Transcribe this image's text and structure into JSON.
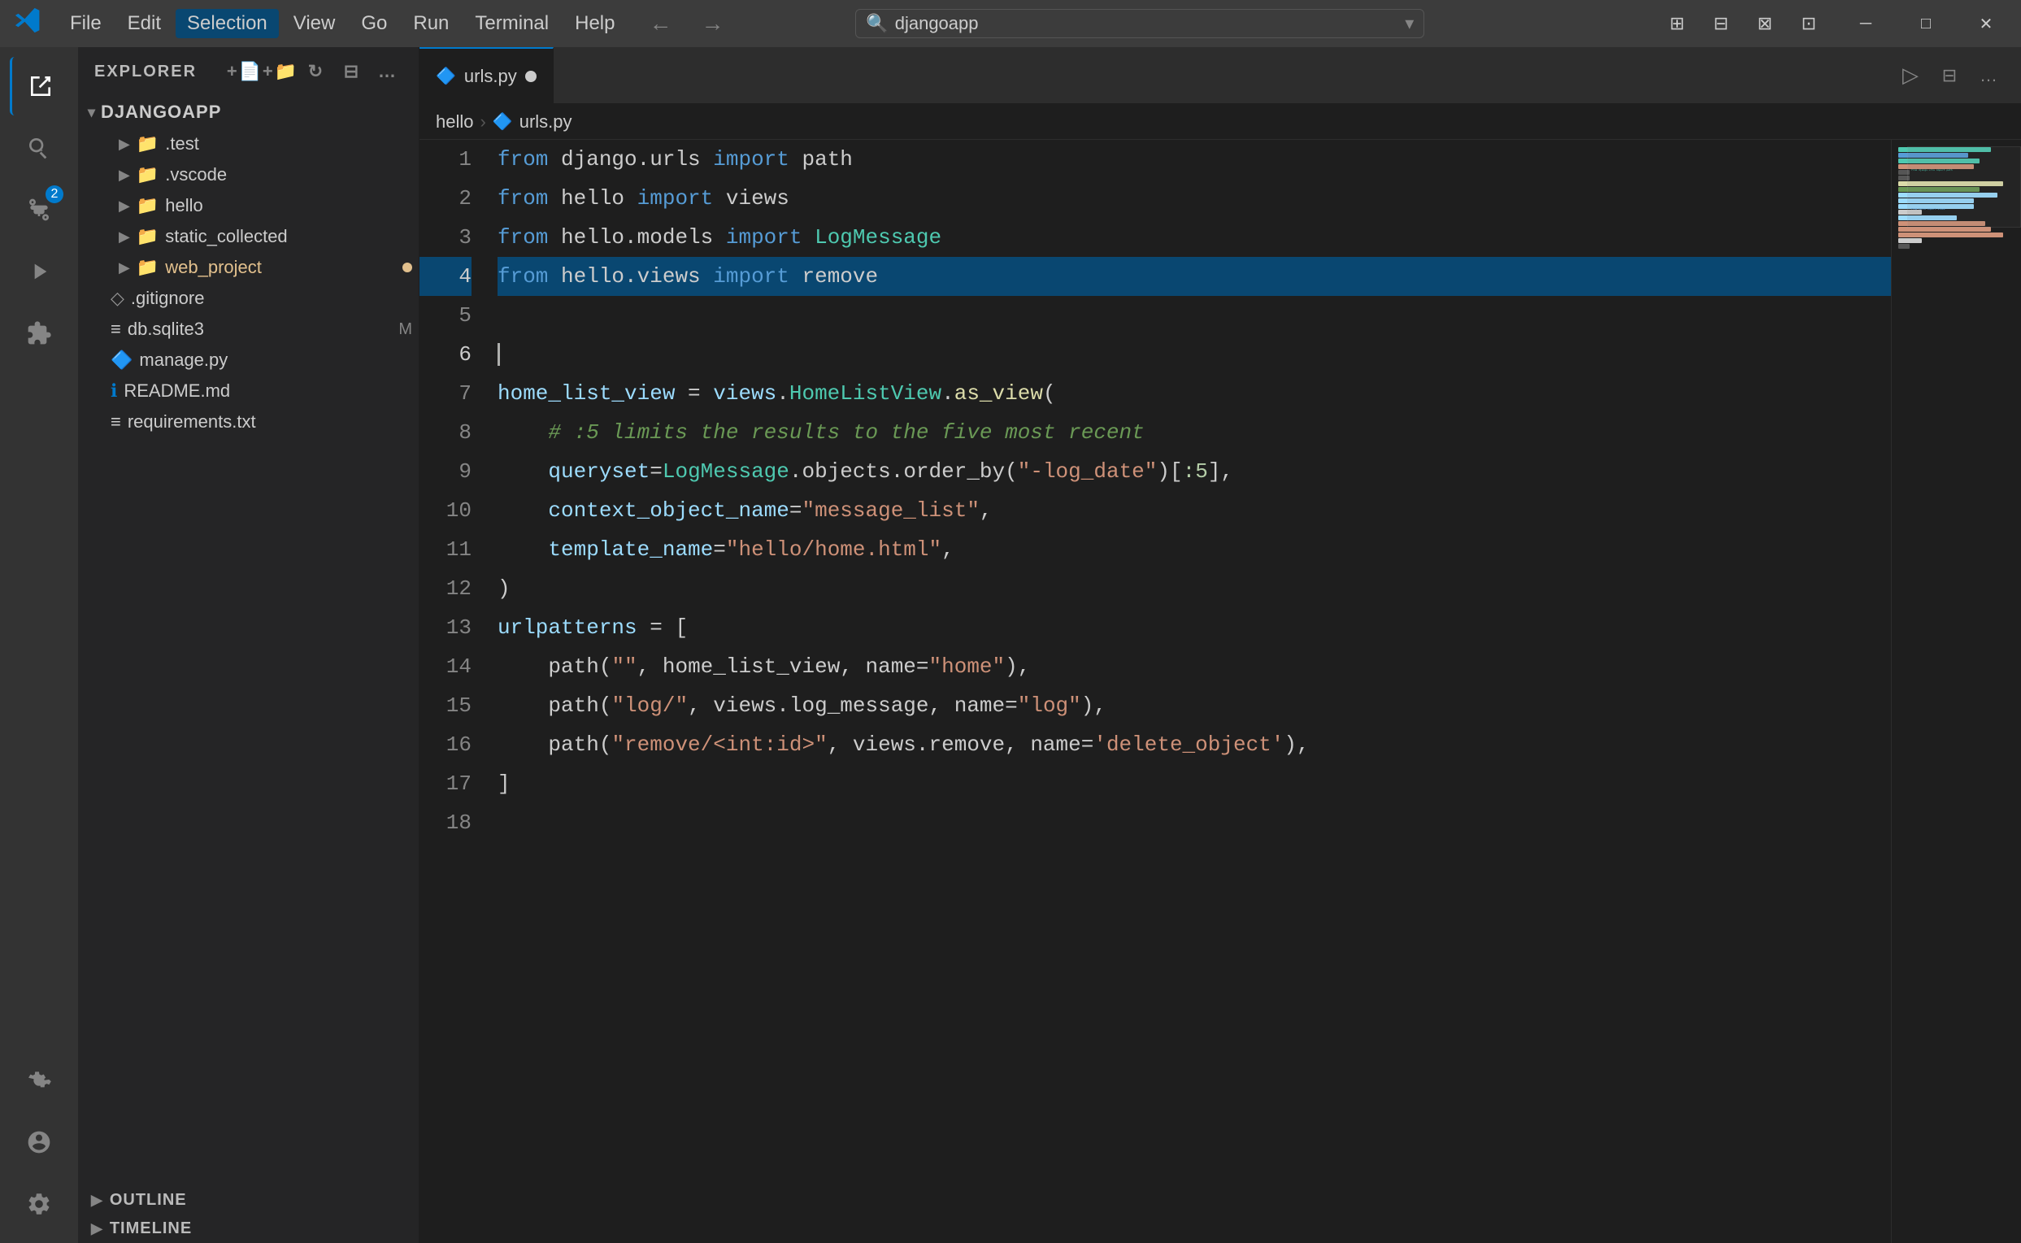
{
  "titlebar": {
    "logo": "vscode-logo",
    "menu": [
      {
        "label": "File",
        "id": "file"
      },
      {
        "label": "Edit",
        "id": "edit"
      },
      {
        "label": "Selection",
        "id": "selection",
        "active": true
      },
      {
        "label": "View",
        "id": "view"
      },
      {
        "label": "Go",
        "id": "go"
      },
      {
        "label": "Run",
        "id": "run"
      },
      {
        "label": "Terminal",
        "id": "terminal"
      },
      {
        "label": "Help",
        "id": "help"
      }
    ],
    "search_placeholder": "djangoapp",
    "nav_back": "←",
    "nav_fwd": "→",
    "layout_icons": [
      "⊞",
      "⊟",
      "⊠",
      "⊡"
    ],
    "win_minimize": "─",
    "win_maximize": "□",
    "win_close": "✕"
  },
  "activity_bar": {
    "icons": [
      {
        "name": "explorer",
        "glyph": "📄",
        "active": true,
        "badge": null
      },
      {
        "name": "search",
        "glyph": "🔍",
        "active": false
      },
      {
        "name": "source-control",
        "glyph": "⎇",
        "active": false,
        "badge": "2"
      },
      {
        "name": "run-debug",
        "glyph": "▷",
        "active": false
      },
      {
        "name": "extensions",
        "glyph": "⊞",
        "active": false
      }
    ],
    "bottom_icons": [
      {
        "name": "remote",
        "glyph": "⊵"
      },
      {
        "name": "account",
        "glyph": "👤"
      },
      {
        "name": "settings",
        "glyph": "⚙"
      }
    ]
  },
  "sidebar": {
    "title": "Explorer",
    "project_name": "DJANGOAPP",
    "folders": [
      {
        "name": ".test",
        "type": "folder",
        "indent": 1
      },
      {
        "name": ".vscode",
        "type": "folder",
        "indent": 1
      },
      {
        "name": "hello",
        "type": "folder",
        "indent": 1
      },
      {
        "name": "static_collected",
        "type": "folder",
        "indent": 1
      },
      {
        "name": "web_project",
        "type": "folder",
        "indent": 1,
        "modified": true
      },
      {
        "name": ".gitignore",
        "type": "file",
        "icon": "◇",
        "indent": 1
      },
      {
        "name": "db.sqlite3",
        "type": "file",
        "icon": "≡",
        "indent": 1,
        "badge": "M"
      },
      {
        "name": "manage.py",
        "type": "file",
        "icon": "🔷",
        "indent": 1
      },
      {
        "name": "README.md",
        "type": "file",
        "icon": "ℹ",
        "indent": 1
      },
      {
        "name": "requirements.txt",
        "type": "file",
        "icon": "≡",
        "indent": 1
      }
    ],
    "outline_label": "Outline",
    "timeline_label": "Timeline"
  },
  "tabs": [
    {
      "label": "urls.py",
      "active": true,
      "unsaved": true,
      "icon": "🔷"
    }
  ],
  "breadcrumb": {
    "parts": [
      "hello",
      ">",
      "urls.py"
    ]
  },
  "code": {
    "lines": [
      {
        "num": 1,
        "tokens": [
          {
            "t": "from",
            "c": "kw-from"
          },
          {
            "t": " django.urls ",
            "c": "kw-none"
          },
          {
            "t": "import",
            "c": "kw-import"
          },
          {
            "t": " path",
            "c": "kw-none"
          }
        ]
      },
      {
        "num": 2,
        "tokens": [
          {
            "t": "from",
            "c": "kw-from"
          },
          {
            "t": " hello ",
            "c": "kw-none"
          },
          {
            "t": "import",
            "c": "kw-import"
          },
          {
            "t": " views",
            "c": "kw-none"
          }
        ]
      },
      {
        "num": 3,
        "tokens": [
          {
            "t": "from",
            "c": "kw-from"
          },
          {
            "t": " hello.models ",
            "c": "kw-none"
          },
          {
            "t": "import",
            "c": "kw-import"
          },
          {
            "t": " LogMessage",
            "c": "cls-name"
          }
        ]
      },
      {
        "num": 4,
        "tokens": [
          {
            "t": "from",
            "c": "kw-from"
          },
          {
            "t": " hello.views ",
            "c": "kw-none"
          },
          {
            "t": "import",
            "c": "kw-import"
          },
          {
            "t": " remove",
            "c": "kw-none"
          }
        ],
        "selected": true
      },
      {
        "num": 5,
        "tokens": []
      },
      {
        "num": 6,
        "tokens": [],
        "cursor": true
      },
      {
        "num": 7,
        "tokens": [
          {
            "t": "home_list_view",
            "c": "var-name"
          },
          {
            "t": " = ",
            "c": "punct"
          },
          {
            "t": "views",
            "c": "var-name"
          },
          {
            "t": ".",
            "c": "punct"
          },
          {
            "t": "HomeListView",
            "c": "cls-name"
          },
          {
            "t": ".",
            "c": "punct"
          },
          {
            "t": "as_view",
            "c": "fn-name"
          },
          {
            "t": "(",
            "c": "punct"
          }
        ]
      },
      {
        "num": 8,
        "tokens": [
          {
            "t": "    # :5 limits the results to the five most recent",
            "c": "comment"
          }
        ]
      },
      {
        "num": 9,
        "tokens": [
          {
            "t": "    queryset",
            "c": "var-name"
          },
          {
            "t": "=",
            "c": "punct"
          },
          {
            "t": "LogMessage",
            "c": "cls-name"
          },
          {
            "t": ".objects.order_by(",
            "c": "kw-none"
          },
          {
            "t": "\"-log_date\"",
            "c": "str-val"
          },
          {
            "t": ")[",
            "c": "punct"
          },
          {
            "t": ":5",
            "c": "num"
          },
          {
            "t": "],",
            "c": "punct"
          }
        ]
      },
      {
        "num": 10,
        "tokens": [
          {
            "t": "    context_object_name",
            "c": "var-name"
          },
          {
            "t": "=",
            "c": "punct"
          },
          {
            "t": "\"message_list\"",
            "c": "str-val"
          },
          {
            "t": ",",
            "c": "punct"
          }
        ]
      },
      {
        "num": 11,
        "tokens": [
          {
            "t": "    template_name",
            "c": "var-name"
          },
          {
            "t": "=",
            "c": "punct"
          },
          {
            "t": "\"hello/home.html\"",
            "c": "str-val"
          },
          {
            "t": ",",
            "c": "punct"
          }
        ]
      },
      {
        "num": 12,
        "tokens": [
          {
            "t": ")",
            "c": "punct"
          }
        ]
      },
      {
        "num": 13,
        "tokens": [
          {
            "t": "urlpatterns",
            "c": "var-name"
          },
          {
            "t": " = [",
            "c": "punct"
          }
        ]
      },
      {
        "num": 14,
        "tokens": [
          {
            "t": "    path(",
            "c": "kw-none"
          },
          {
            "t": "\"\"",
            "c": "str-val"
          },
          {
            "t": ", home_list_view, name=",
            "c": "kw-none"
          },
          {
            "t": "\"home\"",
            "c": "str-val"
          },
          {
            "t": "),",
            "c": "punct"
          }
        ]
      },
      {
        "num": 15,
        "tokens": [
          {
            "t": "    path(",
            "c": "kw-none"
          },
          {
            "t": "\"log/\"",
            "c": "str-val"
          },
          {
            "t": ", views.log_message, name=",
            "c": "kw-none"
          },
          {
            "t": "\"log\"",
            "c": "str-val"
          },
          {
            "t": "),",
            "c": "punct"
          }
        ]
      },
      {
        "num": 16,
        "tokens": [
          {
            "t": "    path(",
            "c": "kw-none"
          },
          {
            "t": "\"remove/<int:id>\"",
            "c": "str-val"
          },
          {
            "t": ", views.remove, name=",
            "c": "kw-none"
          },
          {
            "t": "'delete_object'",
            "c": "str-val"
          },
          {
            "t": "),",
            "c": "punct"
          }
        ]
      },
      {
        "num": 17,
        "tokens": [
          {
            "t": "]",
            "c": "punct"
          }
        ]
      },
      {
        "num": 18,
        "tokens": []
      }
    ]
  },
  "minimap": {
    "lines": [
      {
        "width": "80%",
        "color": "#4ec9b0"
      },
      {
        "width": "60%",
        "color": "#569cd6"
      },
      {
        "width": "70%",
        "color": "#4ec9b0"
      },
      {
        "width": "65%",
        "color": "#ce9178"
      },
      {
        "width": "10%",
        "color": "#555"
      },
      {
        "width": "10%",
        "color": "#555"
      },
      {
        "width": "90%",
        "color": "#dcdcaa"
      },
      {
        "width": "70%",
        "color": "#6a9955"
      },
      {
        "width": "85%",
        "color": "#9cdcfe"
      },
      {
        "width": "65%",
        "color": "#9cdcfe"
      },
      {
        "width": "65%",
        "color": "#9cdcfe"
      },
      {
        "width": "20%",
        "color": "#cccccc"
      },
      {
        "width": "50%",
        "color": "#9cdcfe"
      },
      {
        "width": "75%",
        "color": "#ce9178"
      },
      {
        "width": "80%",
        "color": "#ce9178"
      },
      {
        "width": "90%",
        "color": "#ce9178"
      },
      {
        "width": "20%",
        "color": "#cccccc"
      },
      {
        "width": "10%",
        "color": "#555"
      }
    ]
  }
}
